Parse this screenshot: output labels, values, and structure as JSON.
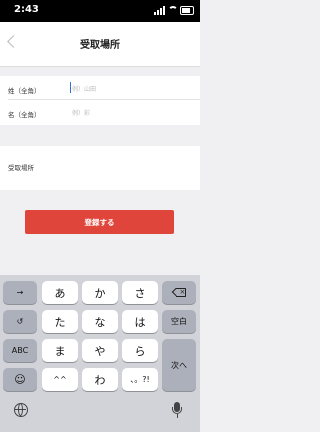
{
  "status_bar": {
    "time": "2:43",
    "icons": [
      "signal-icon",
      "wifi-icon",
      "battery-icon"
    ]
  },
  "nav": {
    "title": "受取場所",
    "back_icon": "chevron-left-icon"
  },
  "form": {
    "last_name": {
      "label": "姓（全角）",
      "placeholder": "例）山田",
      "value": ""
    },
    "first_name": {
      "label": "名（全角）",
      "placeholder": "例）彩",
      "value": ""
    },
    "location": {
      "label": "受取場所"
    }
  },
  "register_button": {
    "label": "登録する"
  },
  "keyboard": {
    "row1": [
      "→",
      "あ",
      "か",
      "さ"
    ],
    "row2": [
      "↺",
      "た",
      "な",
      "は",
      "空白"
    ],
    "row3": [
      "ABC",
      "ま",
      "や",
      "ら"
    ],
    "row4": [
      "☺",
      "^^",
      "わ",
      "、。?!"
    ],
    "enter_label": "次へ",
    "delete_icon": "delete-backspace-icon",
    "globe_icon": "globe-icon",
    "mic_icon": "microphone-icon"
  },
  "colors": {
    "accent": "#e0453b",
    "caret": "#2f6fe0",
    "keyboard_bg": "#d1d3d9"
  }
}
